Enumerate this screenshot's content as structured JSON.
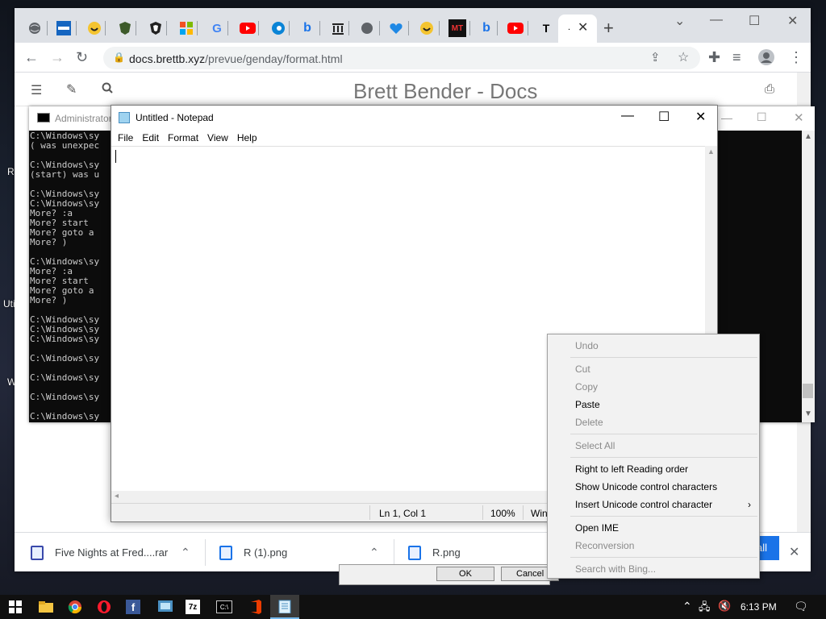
{
  "browser": {
    "url_host": "docs.brettb.xyz",
    "url_path": "/prevue/genday/format.html",
    "active_tab_label": ".",
    "page_title": "Brett Bender - Docs",
    "tab_icons": [
      "globe-icon",
      "vrm-icon",
      "smiley-icon",
      "shield-green-icon",
      "shield-icon",
      "microsoft-icon",
      "google-icon",
      "youtube-icon",
      "edge-icon",
      "bing-icon",
      "building-icon",
      "globe-icon",
      "heart-icon",
      "smiley-icon",
      "mt-icon",
      "bing-icon",
      "youtube-icon",
      "t-icon"
    ],
    "tab_text": {
      "google": "G",
      "mt": "MT",
      "t": "T",
      "bing": "b"
    }
  },
  "downloads": [
    {
      "name": "Five Nights at Fred....rar"
    },
    {
      "name": "R (1).png"
    },
    {
      "name": "R.png"
    }
  ],
  "downloads_fragment": "all",
  "dialog_fragment": {
    "ok": "OK",
    "cancel": "Cancel"
  },
  "console": {
    "title": "Administrator",
    "lines": [
      "C:\\Windows\\sy",
      "( was unexpec",
      "",
      "C:\\Windows\\sy",
      "(start) was u",
      "",
      "C:\\Windows\\sy",
      "C:\\Windows\\sy",
      "More? :a",
      "More? start",
      "More? goto a",
      "More? )",
      "",
      "C:\\Windows\\sy",
      "More? :a",
      "More? start",
      "More? goto a",
      "More? )",
      "",
      "C:\\Windows\\sy",
      "C:\\Windows\\sy",
      "C:\\Windows\\sy",
      "",
      "C:\\Windows\\sy",
      "",
      "C:\\Windows\\sy",
      "",
      "C:\\Windows\\sy",
      "",
      "C:\\Windows\\sy"
    ]
  },
  "notepad": {
    "title": "Untitled - Notepad",
    "menu": [
      "File",
      "Edit",
      "Format",
      "View",
      "Help"
    ],
    "status": {
      "position": "Ln 1, Col 1",
      "zoom": "100%",
      "eol": "Win"
    }
  },
  "context_menu": {
    "undo": "Undo",
    "cut": "Cut",
    "copy": "Copy",
    "paste": "Paste",
    "delete": "Delete",
    "select_all": "Select All",
    "rtl": "Right to left Reading order",
    "show_unicode": "Show Unicode control characters",
    "insert_unicode": "Insert Unicode control character",
    "open_ime": "Open IME",
    "reconversion": "Reconversion",
    "search_bing": "Search with Bing..."
  },
  "desktop_labels": {
    "a": "R",
    "b": "Uti",
    "c": "W"
  },
  "taskbar": {
    "clock": "6:13 PM",
    "apps": [
      "windows-start-icon",
      "file-explorer-icon",
      "chrome-icon",
      "opera-icon",
      "facebook-icon",
      "control-panel-icon",
      "7zip-icon",
      "cmd-icon",
      "office-icon",
      "notepad-icon"
    ],
    "app_text": {
      "facebook": "f",
      "7zip": "7z",
      "cmd": "C:\\"
    }
  },
  "colors": {
    "chrome_tabstrip": "#dee1e6",
    "console_bg": "#0c0c0c",
    "menu_bg": "#f2f2f2",
    "taskbar": "#101010",
    "accent": "#1a73e8"
  }
}
